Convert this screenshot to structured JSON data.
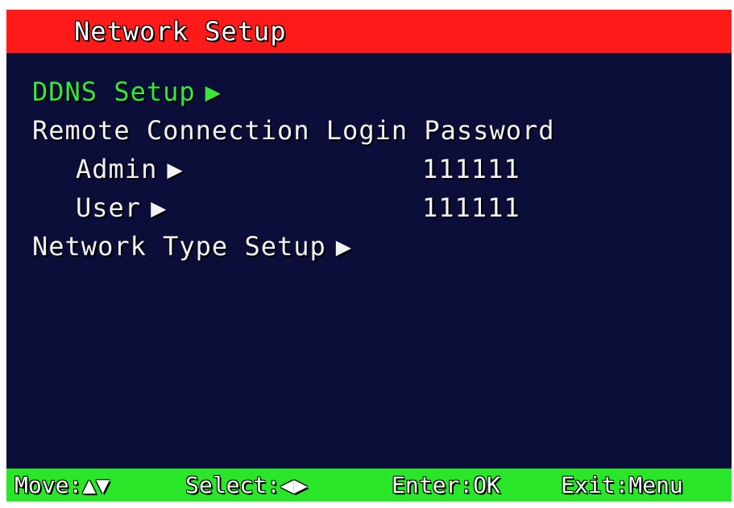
{
  "title": "Network Setup",
  "menu": {
    "ddns": {
      "label": "DDNS Setup",
      "arrow": "▶"
    },
    "remote_heading": "Remote Connection Login Password",
    "admin": {
      "label": "Admin",
      "arrow": "▶",
      "value": "111111"
    },
    "user": {
      "label": "User",
      "arrow": "▶",
      "value": "111111"
    },
    "network_type": {
      "label": "Network Type Setup",
      "arrow": "▶"
    }
  },
  "help": {
    "move_label": "Move:",
    "move_icons": "▲▼",
    "select_label": "Select:",
    "select_icons": "◀▶",
    "enter": "Enter:OK",
    "exit": "Exit:Menu"
  },
  "colors": {
    "title_bar": "#ff1a1a",
    "background": "#0a0e38",
    "help_bar": "#29e629",
    "selected_text": "#39e639",
    "text": "#f2f2f2"
  }
}
